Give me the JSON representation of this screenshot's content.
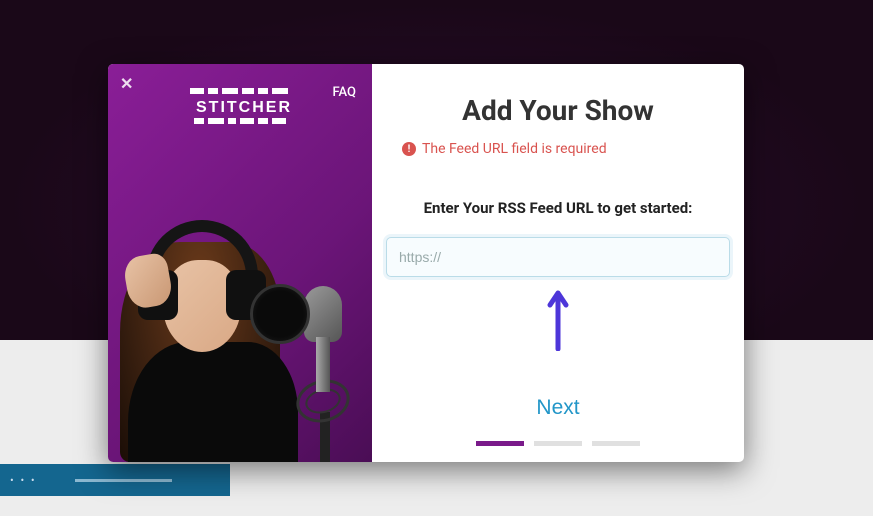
{
  "sidebar": {
    "faq_label": "FAQ",
    "logo_text": "STITCHER"
  },
  "modal": {
    "title": "Add Your Show",
    "error_message": "The Feed URL field is required",
    "prompt_label": "Enter Your RSS Feed URL to get started:",
    "url_placeholder": "https://",
    "next_label": "Next",
    "progress_total": 3,
    "progress_active": 1
  }
}
